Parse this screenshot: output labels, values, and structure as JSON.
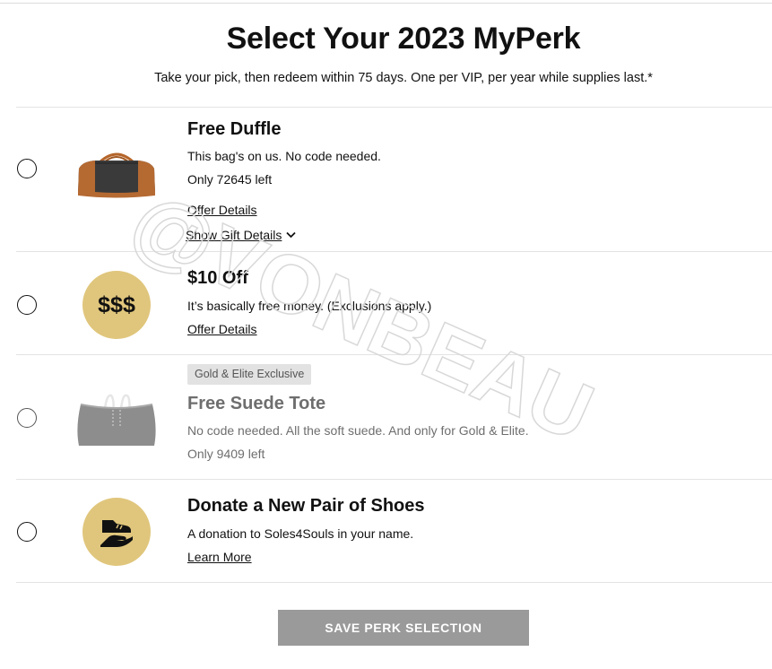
{
  "header": {
    "title": "Select Your 2023 MyPerk",
    "subtitle": "Take your pick, then redeem within 75 days. One per VIP, per year while supplies last.*"
  },
  "perks": [
    {
      "title": "Free Duffle",
      "description": "This bag's on us. No code needed.",
      "stock": "Only 72645 left",
      "offer_link": "Offer Details",
      "gift_toggle": "Show Gift Details"
    },
    {
      "title": "$10 Off",
      "icon_text": "$$$",
      "description": "It’s basically free money. (Exclusions apply.)",
      "offer_link": "Offer Details"
    },
    {
      "badge": "Gold & Elite Exclusive",
      "title": "Free Suede Tote",
      "description": "No code needed. All the soft suede. And only for Gold & Elite.",
      "stock": "Only 9409 left"
    },
    {
      "title": "Donate a New Pair of Shoes",
      "description": "A donation to Soles4Souls in your name.",
      "learn_link": "Learn More"
    }
  ],
  "footer": {
    "save_label": "SAVE PERK SELECTION"
  },
  "watermark": "@VONBEAU",
  "colors": {
    "gold_circle": "#e0c67c",
    "button_disabled": "#9a9a9a",
    "badge_bg": "#e2e2e2",
    "muted_text": "#6e6e6e"
  }
}
